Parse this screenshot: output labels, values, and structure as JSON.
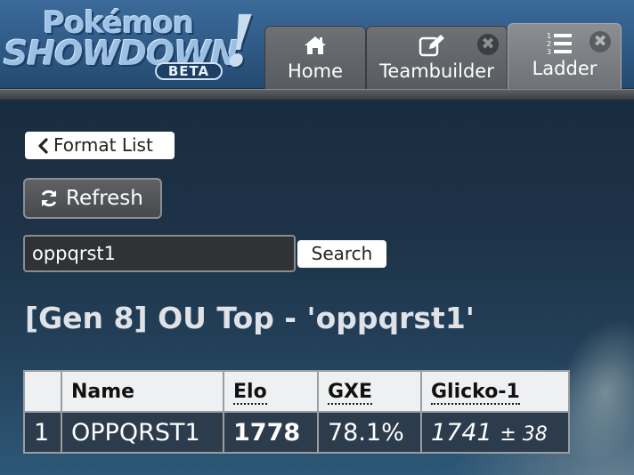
{
  "logo": {
    "line1": "Pokémon",
    "line2": "SHOWDOWN",
    "badge": "BETA",
    "bang": "!"
  },
  "tabs": [
    {
      "label": "Home",
      "icon": "home-icon",
      "closable": false,
      "active": false
    },
    {
      "label": "Teambuilder",
      "icon": "edit-icon",
      "closable": true,
      "active": false
    },
    {
      "label": "Ladder",
      "icon": "list-ol-icon",
      "closable": true,
      "active": true
    }
  ],
  "close_glyph": "✖",
  "content": {
    "format_list_label": "Format List",
    "refresh_label": "Refresh",
    "search_value": "oppqrst1",
    "search_button_label": "Search",
    "page_title": "[Gen 8] OU Top - 'oppqrst1'"
  },
  "table": {
    "headers": [
      "",
      "Name",
      "Elo",
      "GXE",
      "Glicko-1"
    ],
    "rows": [
      {
        "rank": "1",
        "name": "OPPQRST1",
        "elo": "1778",
        "gxe": "78.1%",
        "glicko": "1741",
        "glicko_pm": "±",
        "glicko_dev": "38"
      }
    ]
  },
  "colors": {
    "header_blue": "#2f5a86",
    "tab_grey": "#585b5f",
    "active_tab_grey": "#7c7f83",
    "background": "#1b2d40"
  }
}
